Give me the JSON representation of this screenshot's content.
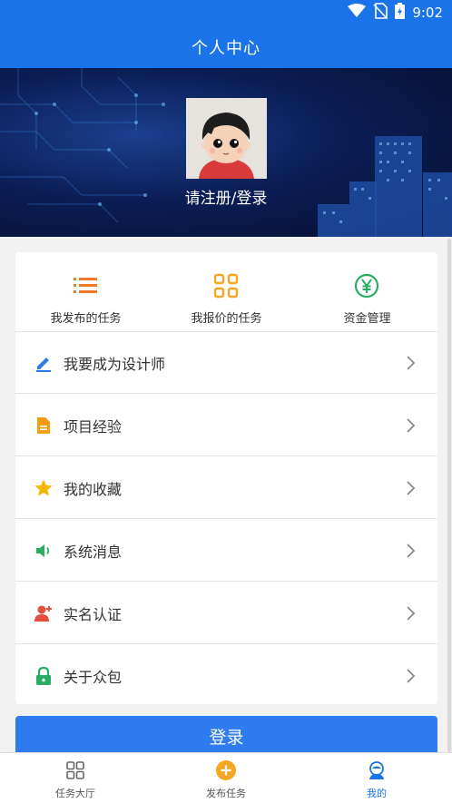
{
  "status_bar": {
    "time": "9:02",
    "icons": [
      "wifi-icon",
      "no-sim-icon",
      "battery-charging-icon"
    ]
  },
  "app_bar": {
    "title": "个人中心"
  },
  "profile": {
    "avatar": "cartoon-avatar",
    "login_prompt": "请注册/登录"
  },
  "quick_actions": [
    {
      "label": "我发布的任务",
      "icon": "list-icon",
      "color": "#f07a2c"
    },
    {
      "label": "我报价的任务",
      "icon": "grid-icon",
      "color": "#f5a623"
    },
    {
      "label": "资金管理",
      "icon": "yuan-icon",
      "color": "#27ae60"
    }
  ],
  "menu": [
    {
      "label": "我要成为设计师",
      "icon": "pencil-icon",
      "color": "#2b7de9"
    },
    {
      "label": "项目经验",
      "icon": "document-icon",
      "color": "#f39c12"
    },
    {
      "label": "我的收藏",
      "icon": "star-icon",
      "color": "#f5b800"
    },
    {
      "label": "系统消息",
      "icon": "speaker-icon",
      "color": "#27ae60"
    },
    {
      "label": "实名认证",
      "icon": "add-user-icon",
      "color": "#e74c3c"
    },
    {
      "label": "关于众包",
      "icon": "lock-icon",
      "color": "#27ae60"
    }
  ],
  "login_button": {
    "label": "登录",
    "color": "#2f7bf0"
  },
  "bottom_nav": [
    {
      "label": "任务大厅",
      "icon": "grid-icon",
      "active": false
    },
    {
      "label": "发布任务",
      "icon": "plus-circle-icon",
      "active": false
    },
    {
      "label": "我的",
      "icon": "user-icon",
      "active": true
    }
  ],
  "colors": {
    "primary": "#1a73e8",
    "hero_dark": "#0b1e55"
  }
}
